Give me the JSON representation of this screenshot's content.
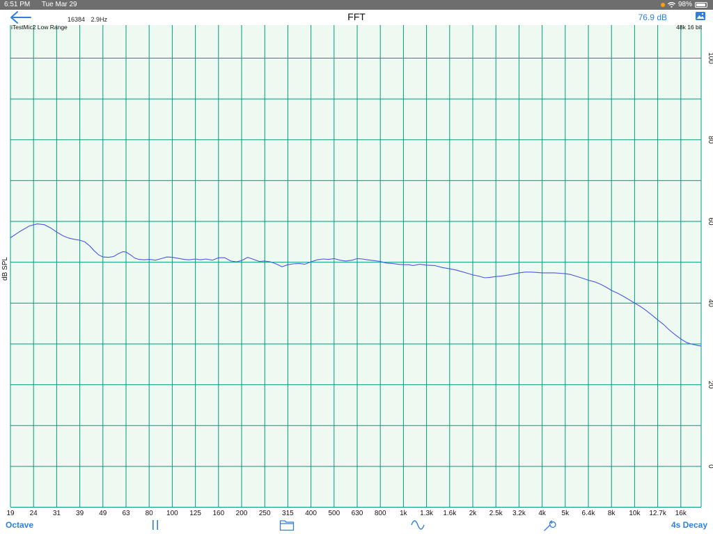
{
  "status": {
    "time": "6:51 PM",
    "date": "Tue Mar 29",
    "battery": "98%"
  },
  "nav": {
    "title": "FFT",
    "fft_size": "16384",
    "resolution": "2.9Hz",
    "level": "76.9 dB",
    "back_icon": "back-arrow-icon",
    "image_icon": "image-icon"
  },
  "chart_data": {
    "type": "line",
    "top_left_label": "iTestMic2 Low Range",
    "top_right_label": "48k 16 bit",
    "ylabel": "dB SPL",
    "ylim": [
      -14,
      104
    ],
    "y_ticks": [
      100,
      80,
      60,
      40,
      20,
      0
    ],
    "x_scale": "log",
    "xlim": [
      19,
      20000
    ],
    "x_ticks": [
      "19",
      "24",
      "31",
      "39",
      "49",
      "63",
      "80",
      "100",
      "125",
      "160",
      "200",
      "250",
      "315",
      "400",
      "500",
      "630",
      "800",
      "1k",
      "1.3k",
      "1.6k",
      "2k",
      "2.5k",
      "3.2k",
      "4k",
      "5k",
      "6.4k",
      "8k",
      "10k",
      "12.7k",
      "16k"
    ],
    "grid": true,
    "colors": {
      "grid": "#009a80",
      "background": "#eefaf1",
      "trace": "#4a55e8"
    },
    "series": [
      {
        "x": [
          19,
          21,
          23,
          25,
          27,
          29,
          31,
          33,
          35,
          37,
          39,
          41,
          43,
          45,
          47,
          49,
          52,
          55,
          58,
          61,
          63,
          66,
          69,
          72,
          76,
          80,
          85,
          90,
          95,
          100,
          105,
          112,
          118,
          125,
          132,
          140,
          150,
          160,
          170,
          180,
          190,
          200,
          212,
          225,
          237,
          250,
          265,
          280,
          297,
          315,
          333,
          355,
          375,
          400,
          425,
          450,
          475,
          500,
          530,
          560,
          600,
          630,
          665,
          700,
          750,
          800,
          850,
          900,
          950,
          1000,
          1060,
          1120,
          1200,
          1300,
          1400,
          1500,
          1600,
          1700,
          1800,
          1900,
          2000,
          2120,
          2240,
          2360,
          2500,
          2650,
          2800,
          3000,
          3200,
          3400,
          3600,
          3800,
          4000,
          4250,
          4500,
          4750,
          5000,
          5300,
          5600,
          6000,
          6400,
          6800,
          7200,
          7600,
          8000,
          8500,
          9000,
          9500,
          10000,
          10600,
          11200,
          12000,
          12700,
          13500,
          14200,
          15000,
          16000,
          17000,
          18000,
          19000,
          20000
        ],
        "y": [
          56.0,
          57.6,
          58.9,
          59.4,
          59.2,
          58.4,
          57.4,
          56.5,
          55.9,
          55.6,
          55.4,
          55.0,
          54.0,
          52.8,
          51.8,
          51.3,
          51.2,
          51.4,
          52.1,
          52.6,
          52.5,
          51.8,
          51.0,
          50.7,
          50.6,
          50.7,
          50.5,
          50.9,
          51.3,
          51.2,
          51.0,
          50.7,
          50.6,
          50.8,
          50.6,
          50.8,
          50.5,
          51.1,
          51.1,
          50.3,
          50.1,
          50.4,
          51.2,
          50.7,
          50.2,
          50.3,
          50.1,
          49.6,
          48.9,
          49.4,
          49.6,
          49.7,
          49.5,
          50.1,
          50.6,
          50.8,
          50.7,
          50.9,
          50.5,
          50.3,
          50.5,
          50.9,
          50.8,
          50.6,
          50.4,
          50.2,
          49.8,
          49.7,
          49.5,
          49.4,
          49.4,
          49.2,
          49.5,
          49.3,
          49.2,
          48.7,
          48.4,
          48.1,
          47.7,
          47.3,
          46.9,
          46.6,
          46.2,
          46.3,
          46.5,
          46.6,
          46.8,
          47.1,
          47.4,
          47.6,
          47.6,
          47.5,
          47.4,
          47.4,
          47.4,
          47.3,
          47.2,
          47.0,
          46.6,
          46.1,
          45.6,
          45.2,
          44.6,
          43.9,
          43.1,
          42.4,
          41.6,
          40.8,
          40.0,
          39.2,
          38.3,
          37.0,
          35.9,
          34.7,
          33.5,
          32.4,
          31.2,
          30.3,
          29.9,
          29.6,
          29.5
        ]
      }
    ]
  },
  "toolbar": {
    "octave_label": "Octave",
    "decay_label": "4s Decay",
    "pause_icon": "pause-icon",
    "folder_icon": "folder-icon",
    "waveform_icon": "sine-wave-icon",
    "settings_icon": "wrench-icon"
  }
}
